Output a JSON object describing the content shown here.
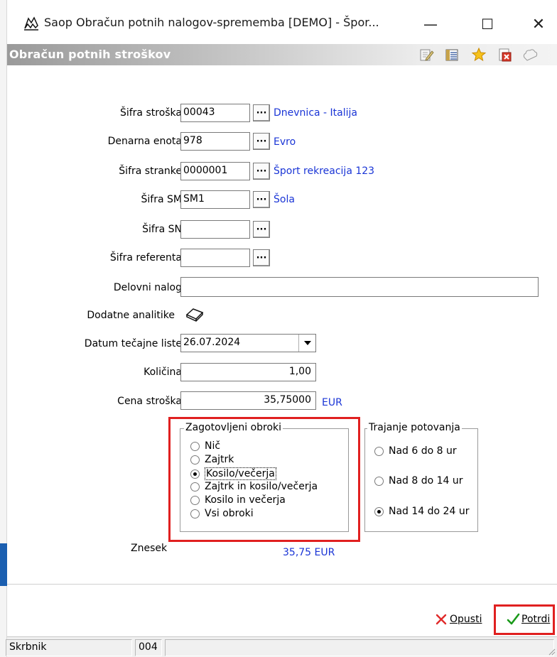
{
  "window": {
    "title": "Saop Obračun potnih nalogov-sprememba [DEMO] - Špor...",
    "minimize": "—",
    "maximize": "☐",
    "close": "✕"
  },
  "header": {
    "title": "Obračun potnih stroškov"
  },
  "form": {
    "sifra_stroska": {
      "label": "Šifra stroška",
      "value": "00043",
      "desc": "Dnevnica - Italija"
    },
    "denarna_enota": {
      "label": "Denarna enota",
      "value": "978",
      "desc": "Evro"
    },
    "sifra_stranke": {
      "label": "Šifra stranke",
      "value": "0000001",
      "desc": "Šport rekreacija 123"
    },
    "sifra_sm": {
      "label": "Šifra SM",
      "value": "SM1",
      "desc": "Šola"
    },
    "sifra_sn": {
      "label": "Šifra SN",
      "value": ""
    },
    "sifra_referenta": {
      "label": "Šifra referenta",
      "value": ""
    },
    "delovni_nalog": {
      "label": "Delovni nalog",
      "value": ""
    },
    "dodatne_analitike": {
      "label": "Dodatne analitike"
    },
    "datum_tecajne_liste": {
      "label": "Datum tečajne liste",
      "value": "26.07.2024"
    },
    "kolicina": {
      "label": "Količina",
      "value": "1,00"
    },
    "cena_stroska": {
      "label": "Cena stroška",
      "value": "35,75000",
      "currency": "EUR"
    },
    "lookup_button": "···"
  },
  "meals": {
    "legend": "Zagotovljeni obroki",
    "options": [
      "Nič",
      "Zajtrk",
      "Kosilo/večerja",
      "Zajtrk in kosilo/večerja",
      "Kosilo in večerja",
      "Vsi obroki"
    ],
    "selected": "Kosilo/večerja"
  },
  "duration": {
    "legend": "Trajanje potovanja",
    "options": [
      "Nad 6 do 8 ur",
      "Nad 8 do 14 ur",
      "Nad 14 do 24 ur"
    ],
    "selected": "Nad 14 do 24 ur"
  },
  "amount": {
    "label": "Znesek",
    "value": "35,75 EUR"
  },
  "buttons": {
    "cancel": "Opusti",
    "confirm": "Potrdi"
  },
  "status": {
    "user": "Skrbnik",
    "code": "004"
  },
  "colors": {
    "link": "#1a35d6",
    "highlight": "#e02020",
    "header_gradient_start": "#9a9a9a"
  }
}
